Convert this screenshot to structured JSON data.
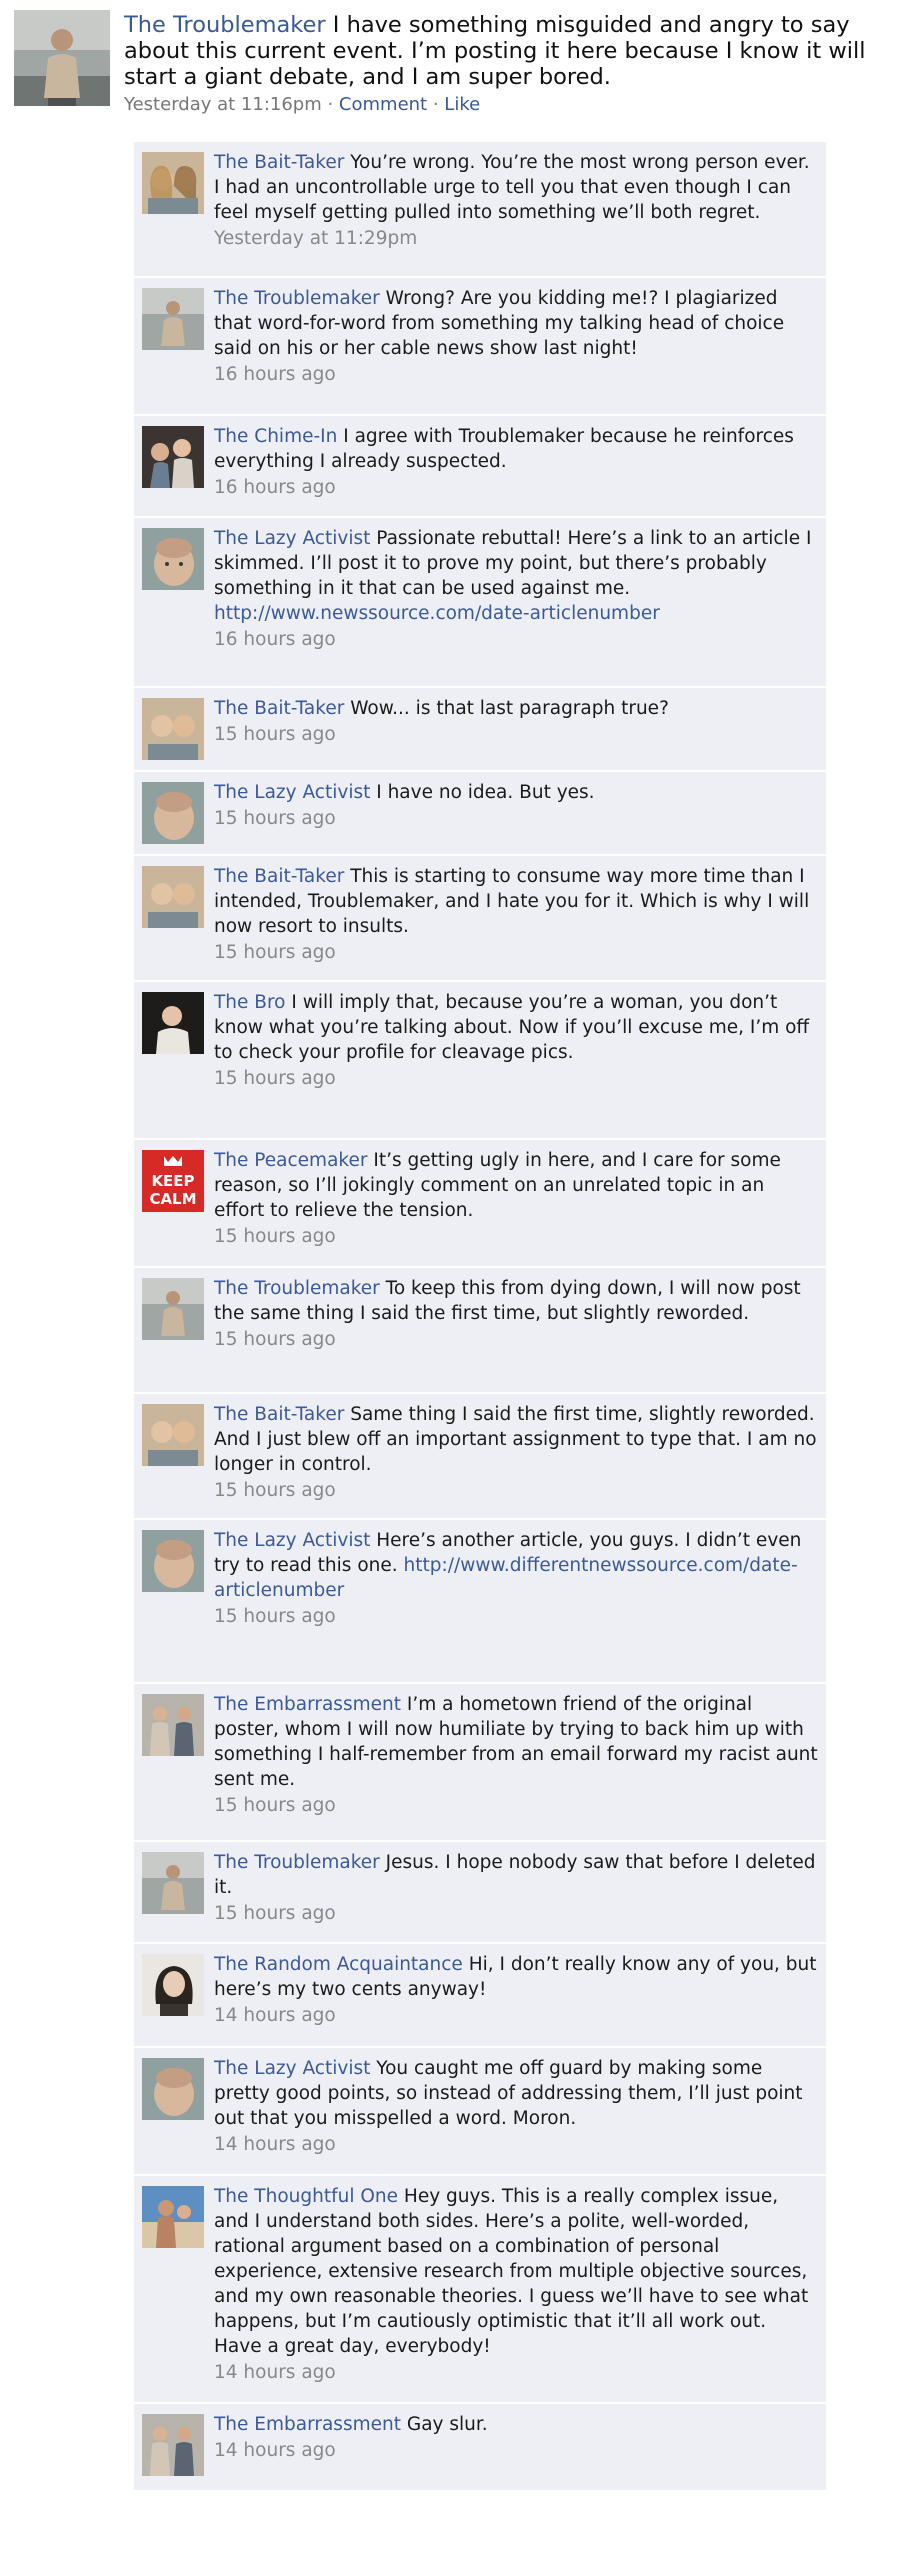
{
  "post": {
    "author": "The Troublemaker",
    "text": "I have something misguided and angry to say about this current event. I’m posting it here because I know it will start a giant debate, and I am super bored.",
    "time": "Yesterday at 11:16pm",
    "sep1": " · ",
    "comment_label": "Comment",
    "sep2": " · ",
    "like_label": "Like"
  },
  "comments": [
    {
      "author": "The Bait-Taker",
      "text": "You’re wrong. You’re the most wrong person ever. I had an uncontrollable urge to tell you that even though I can feel myself getting pulled into something we’ll both regret.",
      "time": "Yesterday at 11:29pm",
      "avatar": "bait-taker-avatar"
    },
    {
      "author": "The Troublemaker",
      "text": "Wrong? Are you kidding me!? I plagiarized that word-for-word from something my talking head of choice said on his or her cable news show last night!",
      "time": "16 hours ago",
      "avatar": "troublemaker-avatar"
    },
    {
      "author": "The Chime-In",
      "text": "I agree with Troublemaker because he reinforces everything I already suspected.",
      "time": "16 hours ago",
      "avatar": "chime-in-avatar"
    },
    {
      "author": "The Lazy Activist",
      "text": "Passionate rebuttal! Here’s a link to an article I skimmed. I’ll post it to prove my point, but there’s probably something in it that can be used against me.",
      "link": "http://www.newssource.com/date-articlenumber",
      "time": "16 hours ago",
      "avatar": "lazy-activist-avatar"
    },
    {
      "author": "The Bait-Taker",
      "text": "Wow... is that last paragraph true?",
      "time": "15 hours ago",
      "avatar": "bait-taker-avatar"
    },
    {
      "author": "The Lazy Activist",
      "text": "I have no idea. But yes.",
      "time": "15 hours ago",
      "avatar": "lazy-activist-avatar"
    },
    {
      "author": "The Bait-Taker",
      "text": "This is starting to consume way more time than I intended, Troublemaker, and I hate you for it. Which is why I will now resort to insults.",
      "time": "15 hours ago",
      "avatar": "bait-taker-avatar"
    },
    {
      "author": "The Bro",
      "text": "I will imply that, because you’re a woman, you don’t know what you’re talking about. Now if you’ll excuse me, I’m off to check your profile for cleavage pics.",
      "time": "15 hours ago",
      "avatar": "bro-avatar"
    },
    {
      "author": "The Peacemaker",
      "text": "It’s getting ugly in here, and I care for some reason, so I’ll jokingly comment on an unrelated topic in an effort to relieve the tension.",
      "time": "15 hours ago",
      "avatar": "peacemaker-avatar",
      "keep": "KEEP",
      "calm": "CALM"
    },
    {
      "author": "The Troublemaker",
      "text": "To keep this from dying down, I will now post the same thing I said the first time, but slightly reworded.",
      "time": "15 hours ago",
      "avatar": "troublemaker-avatar"
    },
    {
      "author": "The Bait-Taker",
      "text": "Same thing I said the first time, slightly reworded. And I just blew off an important assignment to type that. I am no longer in control.",
      "time": "15 hours ago",
      "avatar": "bait-taker-avatar"
    },
    {
      "author": "The Lazy Activist",
      "text": "Here’s another article, you guys. I didn’t even try to read this one.",
      "link": "http://www.differentnewssource.com/date-articlenumber",
      "time": "15 hours ago",
      "avatar": "lazy-activist-avatar"
    },
    {
      "author": "The Embarrassment",
      "text": "I’m a hometown friend of the original poster, whom I will now humiliate by trying to back him up with something I half-remember from an email forward my racist aunt sent me.",
      "time": "15 hours ago",
      "avatar": "embarrassment-avatar"
    },
    {
      "author": "The Troublemaker",
      "text": "Jesus. I hope nobody saw that before I deleted it.",
      "time": "15 hours ago",
      "avatar": "troublemaker-avatar"
    },
    {
      "author": "The Random Acquaintance",
      "text": "Hi, I don’t really know any of you, but here’s my two cents anyway!",
      "time": "14 hours ago",
      "avatar": "random-acquaintance-avatar"
    },
    {
      "author": "The Lazy Activist",
      "text": "You caught me off guard by making some pretty good points, so instead of addressing them, I’ll just point out that you misspelled a word. Moron.",
      "time": "14 hours ago",
      "avatar": "lazy-activist-avatar"
    },
    {
      "author": "The Thoughtful One",
      "text": "Hey guys. This is a really complex issue, and I understand both sides. Here’s a polite, well-worded, rational argument based on a combination of personal experience, extensive research from multiple objective sources, and my own reasonable theories. I guess we’ll have to see what happens, but I’m cautiously optimistic that it’ll all work out. Have a great day, everybody!",
      "time": "14 hours ago",
      "avatar": "thoughtful-one-avatar"
    },
    {
      "author": "The Embarrassment",
      "text": "Gay slur.",
      "time": "14 hours ago",
      "avatar": "embarrassment-avatar"
    }
  ],
  "colors": {
    "link": "#3b5998",
    "comment_bg": "#edeff4",
    "meta": "#888888",
    "keep_calm_red": "#d72a26"
  }
}
